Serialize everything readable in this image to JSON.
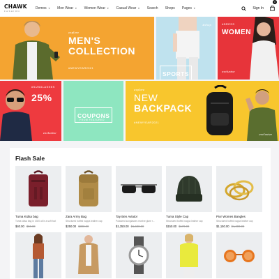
{
  "brand": {
    "name": "CHAWK",
    "tagline": "FASHION"
  },
  "nav": [
    {
      "label": "Demos",
      "dropdown": true
    },
    {
      "label": "Men Wear",
      "dropdown": true
    },
    {
      "label": "Women Wear",
      "dropdown": true
    },
    {
      "label": "Casual Wear",
      "dropdown": true
    },
    {
      "label": "Search",
      "dropdown": false
    },
    {
      "label": "Shops",
      "dropdown": false
    },
    {
      "label": "Pages",
      "dropdown": true
    }
  ],
  "header": {
    "signin": "Sign In",
    "cart_count": "0"
  },
  "banners": {
    "men": {
      "tag": "explore",
      "title_line1": "MEN'S",
      "title_line2": "COLLECTION",
      "hashtag": "#NEWYEAR2021"
    },
    "sports": {
      "tag": "#shop",
      "title": "SPORTS"
    },
    "women": {
      "tag": "#DRESS",
      "title": "WOMEN",
      "footer": "exclusive"
    },
    "sunglasses": {
      "tag": "#SUNGLASSES",
      "percent": "25%",
      "footer": "exclusive"
    },
    "coupons": {
      "title": "COUPONS",
      "sub": "FROM FEATURED"
    },
    "backpack": {
      "tag": "explore",
      "title_line1": "NEW",
      "title_line2": "BACKPACK",
      "hashtag": "#NEWYEAR2021",
      "footer": "exclusive"
    }
  },
  "flash_sale": {
    "title": "Flash Sale",
    "products": [
      {
        "name": "Tuma Kidsa bag",
        "desc": "Tuma kidsa bag in 1920 all in a soft foot",
        "price": "$40.00",
        "old_price": "$50.00",
        "icon": "backpack-icon"
      },
      {
        "name": "Zara Army Bag",
        "desc": "Structured buffed nappa leather cap",
        "price": "$250.00",
        "old_price": "$300.00",
        "icon": "army-bag-icon"
      },
      {
        "name": "Tay Ben Aviator",
        "desc": "Polarized sunglasses receive glare r...",
        "price": "$1,350.00",
        "old_price": "$1,500.00",
        "icon": "sunglasses-icon"
      },
      {
        "name": "Tuma Style Cap",
        "desc": "Structured buffed nappa leather cap",
        "price": "$150.00",
        "old_price": "$170.00",
        "icon": "beanie-icon"
      },
      {
        "name": "Pior Womes Bangles",
        "desc": "Structured buffed nappa leather cap",
        "price": "$1,150.00",
        "old_price": "$1,200.00",
        "icon": "bangles-icon"
      },
      {
        "name": "",
        "desc": "",
        "price": "",
        "old_price": "",
        "icon": "model-icon"
      },
      {
        "name": "",
        "desc": "",
        "price": "",
        "old_price": "",
        "icon": "model-icon"
      },
      {
        "name": "",
        "desc": "",
        "price": "",
        "old_price": "",
        "icon": "watch-icon"
      },
      {
        "name": "",
        "desc": "",
        "price": "",
        "old_price": "",
        "icon": "model-icon"
      },
      {
        "name": "",
        "desc": "",
        "price": "",
        "old_price": "",
        "icon": "sunglasses-icon"
      }
    ]
  },
  "colors": {
    "orange": "#f4a431",
    "light_blue": "#bfe2ee",
    "red": "#e7343a",
    "mint": "#8ee6c0",
    "yellow": "#f8c62d"
  }
}
